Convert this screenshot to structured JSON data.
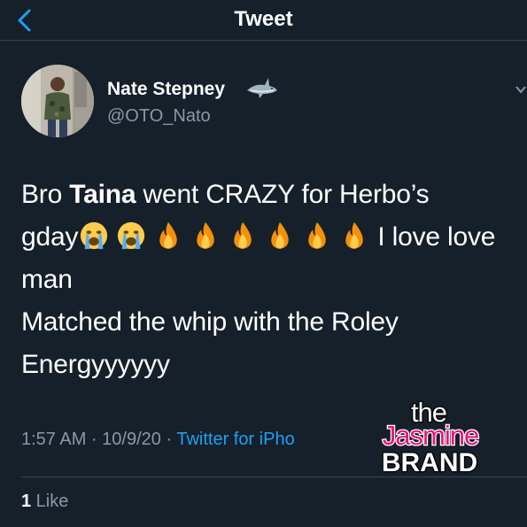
{
  "header": {
    "title": "Tweet",
    "back_icon": "chevron-left-icon",
    "accent_color": "#1da1f2"
  },
  "author": {
    "display_name": "Nate Stepney",
    "name_emoji": "shark-icon",
    "username": "@OTO_Nato"
  },
  "tweet": {
    "line1_pre": "Bro ",
    "line1_bold": "Taina",
    "line1_post": " went CRAZY for Herbo’s",
    "line2_pre": "gday",
    "line2_emojis": [
      "loudly-crying-face-icon",
      "loudly-crying-face-icon",
      "fire-icon",
      "fire-icon",
      "fire-icon",
      "fire-icon",
      "fire-icon",
      "fire-icon"
    ],
    "line2_post": " I love love",
    "line3": "man",
    "line4": "Matched the whip with the Roley",
    "line5": "Energyyyyyy"
  },
  "meta": {
    "time": "1:57 AM",
    "sep1": " · ",
    "date": "10/9/20",
    "sep2": " · ",
    "source": "Twitter for iPho"
  },
  "watermark": {
    "the": "the",
    "jasmine": "Jasmine",
    "brand": "BRAND"
  },
  "stats": {
    "like_count": "1",
    "like_label": " Like"
  },
  "colors": {
    "background": "#15202b",
    "secondary_text": "#8899a6",
    "divider": "#38444d",
    "watermark_pink": "#e8157a"
  }
}
